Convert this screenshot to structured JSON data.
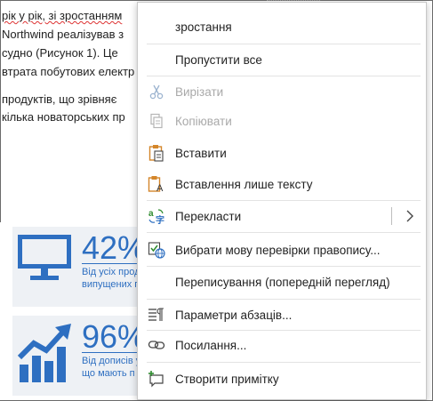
{
  "document": {
    "lines": [
      "рік у рік, зі зростанням",
      "Northwind реалізував з",
      "судно (Рисунок 1). Це",
      "втрата побутових електр",
      "продуктів, що зрівняє",
      "кілька новаторських пр"
    ],
    "stat1": {
      "percent": "42%",
      "desc_line1": "Від усіх прод",
      "desc_line2": "випущених п"
    },
    "stat2": {
      "percent": "96%",
      "desc_line1": "Від дописів у",
      "desc_line2": "що мають п"
    }
  },
  "context_menu": {
    "suggestion": "зростання",
    "ignore_all": "Пропустити все",
    "cut": "Вирізати",
    "copy": "Копіювати",
    "paste": "Вставити",
    "paste_text_only": "Вставлення лише тексту",
    "translate": "Перекласти",
    "set_proofing_language": "Вибрати мову перевірки правопису...",
    "rewrite_preview": "Переписування (попередній перегляд)",
    "paragraph_options": "Параметри абзаців...",
    "link": "Посилання...",
    "new_comment": "Створити примітку"
  },
  "colors": {
    "accent_blue": "#2e6fc1",
    "paste_orange": "#d4862a",
    "disabled_text": "#a9a9a9",
    "spell_squiggle": "#dd3333"
  }
}
